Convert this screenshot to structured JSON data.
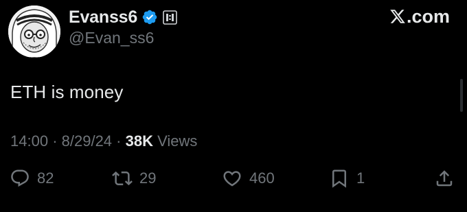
{
  "header": {
    "display_name": "Evanss6",
    "handle": "@Evan_ss6",
    "avatar_icon": "cartoon-face-avatar",
    "verified_icon": "verified-badge-icon",
    "affiliation_icon": "affiliate-badge-icon",
    "brand_text": ".com",
    "brand_icon": "x-logo-icon"
  },
  "tweet": {
    "text": "ETH is money"
  },
  "meta": {
    "time": "14:00",
    "separator": "·",
    "date": "8/29/24",
    "views_count": "38K",
    "views_label": "Views"
  },
  "actions": {
    "replies": "82",
    "reposts": "29",
    "likes": "460",
    "bookmarks": "1"
  },
  "colors": {
    "background": "#000000",
    "primary_text": "#e7e9ea",
    "secondary_text": "#71767b",
    "verified_blue": "#1d9bf0"
  }
}
